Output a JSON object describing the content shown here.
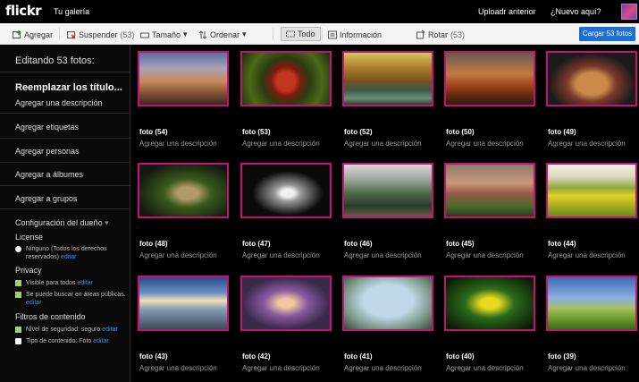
{
  "topbar": {
    "logo": "flickr",
    "gallery": "Tu galería",
    "upload_previous": "Uploadr anterior",
    "whats_new": "¿Nuevo aquí?"
  },
  "toolbar": {
    "add": "Agregar",
    "suspend": "Suspender",
    "suspend_count": "(53)",
    "size": "Tamaño",
    "sort": "Ordenar",
    "all": "Todo",
    "info": "Información",
    "rotate": "Rotar",
    "rotate_count": "(53)",
    "upload_button": "Cargar 53 fotos"
  },
  "sidebar": {
    "editing": "Editando 53 fotos:",
    "replace_titles": "Reemplazar los título...",
    "add_description": "Agregar una descripción",
    "add_tags": "Agregar etiquetas",
    "add_people": "Agregar personas",
    "add_albums": "Agregar a álbumes",
    "add_groups": "Agregar a grupos",
    "owner_settings": "Configuración del dueño",
    "license_heading": "License",
    "license_value": "Ninguno (Todos los derechos reservados)",
    "privacy_heading": "Privacy",
    "privacy_visible": "Visible para todos",
    "privacy_search": "Se puede buscar en áreas públicas.",
    "content_heading": "Filtros de contenido",
    "safety_level": "Nivel de seguridad: seguro",
    "content_type": "Tipo de contenido: Foto",
    "edit": "editar"
  },
  "photos": [
    {
      "caption": "foto (54)",
      "desc": "Agregar una descripción"
    },
    {
      "caption": "foto (53)",
      "desc": "Agregar una descripción"
    },
    {
      "caption": "foto (52)",
      "desc": "Agregar una descripción"
    },
    {
      "caption": "foto (50)",
      "desc": "Agregar una descripción"
    },
    {
      "caption": "foto (49)",
      "desc": "Agregar una descripción"
    },
    {
      "caption": "foto (48)",
      "desc": "Agregar una descripción"
    },
    {
      "caption": "foto (47)",
      "desc": "Agregar una descripción"
    },
    {
      "caption": "foto (46)",
      "desc": "Agregar una descripción"
    },
    {
      "caption": "foto (45)",
      "desc": "Agregar una descripción"
    },
    {
      "caption": "foto (44)",
      "desc": "Agregar una descripción"
    },
    {
      "caption": "foto (43)",
      "desc": "Agregar una descripción"
    },
    {
      "caption": "foto (42)",
      "desc": "Agregar una descripción"
    },
    {
      "caption": "foto (41)",
      "desc": "Agregar una descripción"
    },
    {
      "caption": "foto (40)",
      "desc": "Agregar una descripción"
    },
    {
      "caption": "foto (39)",
      "desc": "Agregar una descripción"
    }
  ],
  "colors": {
    "selection_border": "#c5127a",
    "accent_blue": "#1d6ed8",
    "check_green": "#9ed26a"
  }
}
